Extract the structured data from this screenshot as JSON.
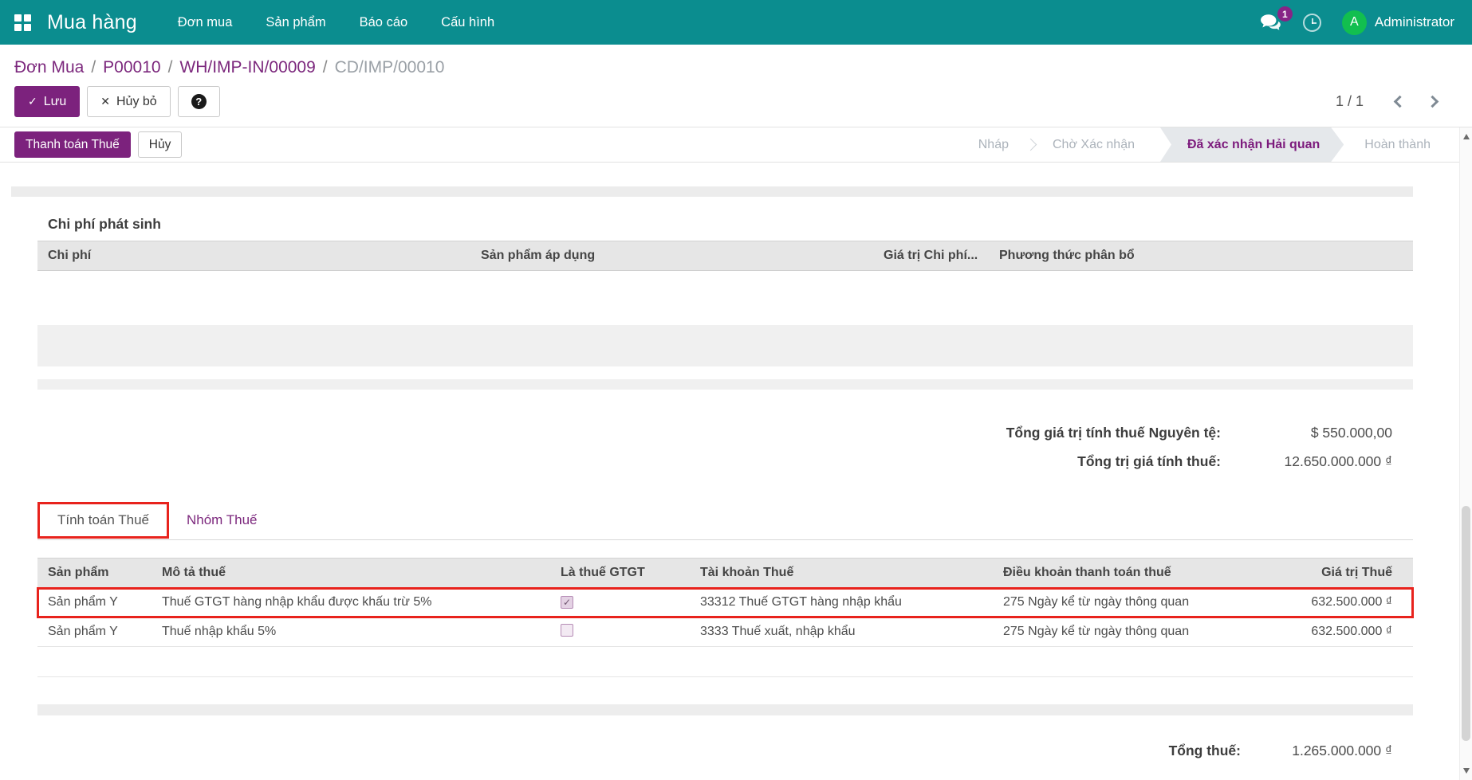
{
  "navbar": {
    "brand": "Mua hàng",
    "menu": [
      "Đơn mua",
      "Sản phẩm",
      "Báo cáo",
      "Cấu hình"
    ],
    "messages_badge": "1",
    "user_name": "Administrator",
    "avatar_letter": "A"
  },
  "breadcrumb": {
    "items": [
      "Đơn Mua",
      "P00010",
      "WH/IMP-IN/00009",
      "CD/IMP/00010"
    ],
    "separator": "/"
  },
  "actions": {
    "save_label": "Lưu",
    "discard_label": "Hủy bỏ",
    "pager_value": "1 / 1"
  },
  "statusbar": {
    "pay_tax_label": "Thanh toán Thuế",
    "cancel_label": "Hủy",
    "states": [
      "Nháp",
      "Chờ Xác nhận",
      "Đã xác nhận Hải quan",
      "Hoàn thành"
    ],
    "active_state": "Đã xác nhận Hải quan"
  },
  "costs_section": {
    "title": "Chi phí phát sinh",
    "columns": [
      "Chi phí",
      "Sản phẩm áp dụng",
      "Giá trị Chi phí...",
      "Phương thức phân bổ"
    ],
    "rows": []
  },
  "summary": {
    "original_label": "Tổng giá trị tính thuế Nguyên tệ:",
    "original_value": "$ 550.000,00",
    "vnd_label": "Tổng trị giá tính thuế:",
    "vnd_value": "12.650.000.000 ₫"
  },
  "tabs": [
    {
      "label": "Tính toán Thuế",
      "active": true,
      "annotated": true
    },
    {
      "label": "Nhóm Thuế",
      "active": false,
      "annotated": false
    }
  ],
  "tax_table": {
    "columns": [
      "Sản phẩm",
      "Mô tả thuế",
      "Là thuế GTGT",
      "Tài khoản Thuế",
      "Điều khoản thanh toán thuế",
      "Giá trị Thuế"
    ],
    "rows": [
      {
        "product": "Sản phẩm Y",
        "description": "Thuế GTGT hàng nhập khẩu được khấu trừ 5%",
        "is_vat": true,
        "account": "33312 Thuế GTGT hàng nhập khẩu",
        "payment_term": "275 Ngày kể từ ngày thông quan",
        "amount": "632.500.000 ₫",
        "annotated": true
      },
      {
        "product": "Sản phẩm Y",
        "description": "Thuế nhập khẩu 5%",
        "is_vat": false,
        "account": "3333 Thuế xuất, nhập khẩu",
        "payment_term": "275 Ngày kể từ ngày thông quan",
        "amount": "632.500.000 ₫",
        "annotated": false
      }
    ],
    "total_label": "Tổng thuế:",
    "total_value": "1.265.000.000 ₫"
  },
  "colors": {
    "navbar_teal": "#0b8d8f",
    "primary_purple": "#7c227d",
    "annotation_red": "#e8231d",
    "avatar_green": "#12bf4f",
    "active_state_bg": "#e5e8eb"
  }
}
